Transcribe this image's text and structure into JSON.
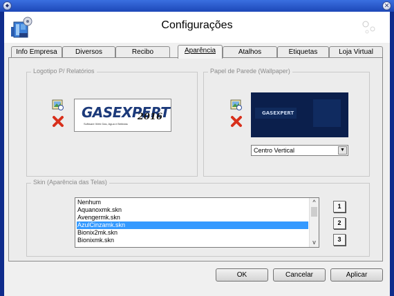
{
  "window": {
    "title": "Configurações"
  },
  "tabs": [
    {
      "label": "Info Empresa"
    },
    {
      "label": "Diversos"
    },
    {
      "label": "Recibo"
    },
    {
      "label": "Aparência"
    },
    {
      "label": "Atalhos"
    },
    {
      "label": "Etiquetas"
    },
    {
      "label": "Loja Virtual"
    }
  ],
  "logo_group": {
    "title": "Logotipo P/ Relatórios",
    "logo": {
      "text": "GASEXPERT",
      "year": "2016",
      "tagline": "Software Web Gas, Agua e Bebidas"
    }
  },
  "wallpaper_group": {
    "title": "Papel de Parede (Wallpaper)",
    "preview_text": "GASEXPERT",
    "position_select": {
      "value": "Centro Vertical"
    }
  },
  "skin_group": {
    "title": "Skin (Aparência das Telas)",
    "items": [
      "Nenhum",
      "Aquanoxmk.skn",
      "Avengermk.skn",
      "AzulCinzamk.skn",
      "Bionix2mk.skn",
      "Bionixmk.skn"
    ],
    "selected": "AzulCinzamk.skn",
    "number_buttons": [
      "1",
      "2",
      "3"
    ]
  },
  "footer": {
    "ok_label": "OK",
    "cancel_label": "Cancelar",
    "apply_label": "Aplicar"
  },
  "colors": {
    "title_bar": "#1d48b8",
    "selection": "#3399ff",
    "logo_blue": "#1c3a7a"
  },
  "icons": [
    "window-system-icon",
    "window-close-icon",
    "app-settings-icon",
    "load-image-icon",
    "delete-icon",
    "scroll-up-icon",
    "scroll-down-icon",
    "dropdown-arrow-icon"
  ]
}
